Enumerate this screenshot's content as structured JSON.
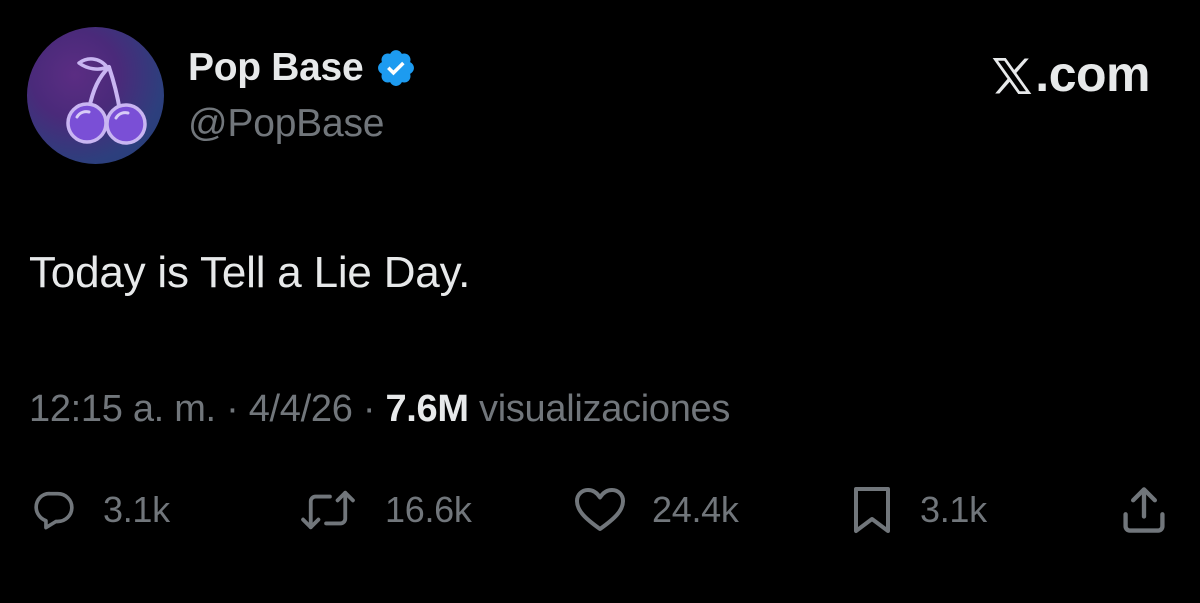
{
  "account": {
    "display_name": "Pop Base",
    "handle": "@PopBase",
    "verified_icon": "verified-badge-icon",
    "avatar_icon": "cherries-icon"
  },
  "brand": {
    "label": ".com",
    "logo_icon": "x-logo-icon"
  },
  "tweet": {
    "text": "Today is Tell a Lie Day."
  },
  "meta": {
    "time": "12:15 a. m.",
    "separator": "·",
    "date": "4/4/26",
    "views_count": "7.6M",
    "views_label": "visualizaciones"
  },
  "actions": {
    "reply": {
      "icon": "reply-icon",
      "count": "3.1k"
    },
    "repost": {
      "icon": "repost-icon",
      "count": "16.6k"
    },
    "like": {
      "icon": "heart-icon",
      "count": "24.4k"
    },
    "bookmark": {
      "icon": "bookmark-icon",
      "count": "3.1k"
    },
    "share": {
      "icon": "share-icon"
    }
  },
  "colors": {
    "background": "#000000",
    "primary_text": "#e7e9ea",
    "secondary_text": "#71767b",
    "verified_blue": "#1d9bf0"
  }
}
